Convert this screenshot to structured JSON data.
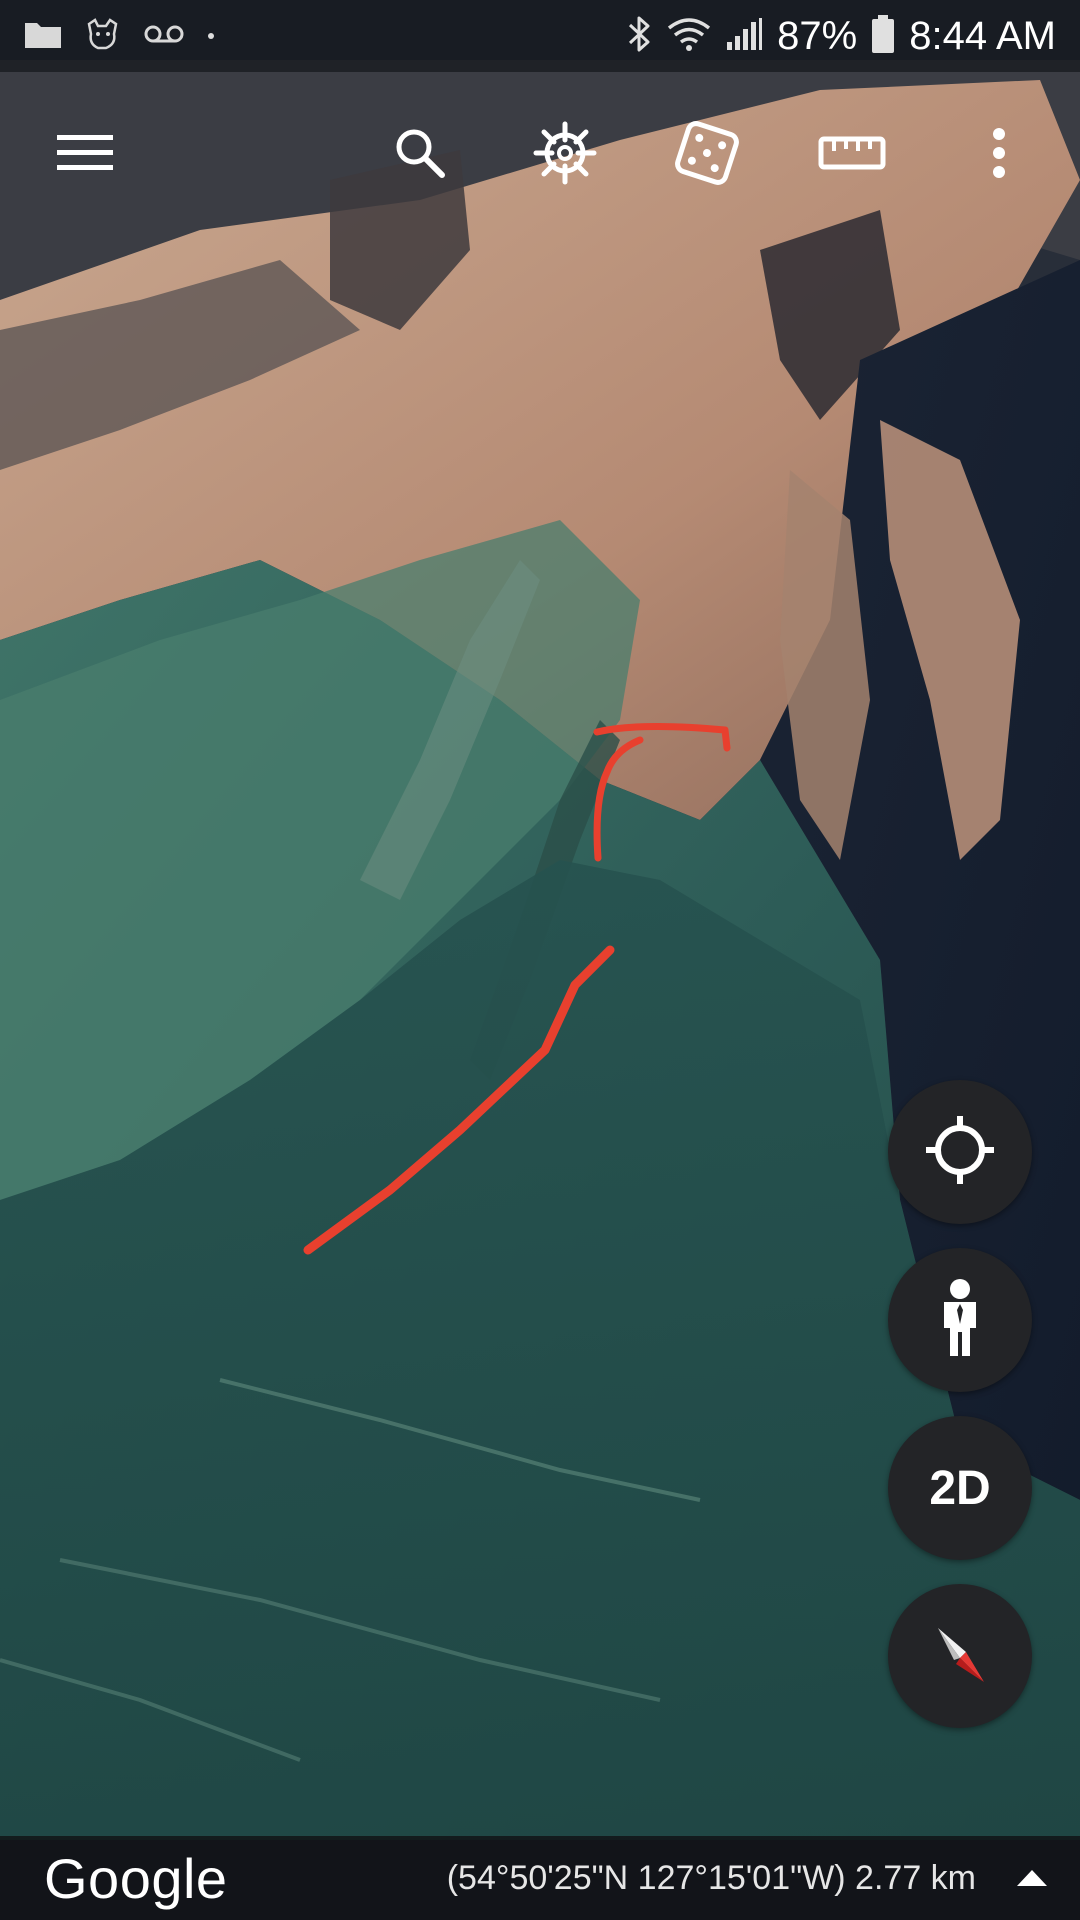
{
  "status_bar": {
    "battery_percent": "87%",
    "time": "8:44 AM",
    "left_icons": [
      "folder-icon",
      "cat-icon",
      "voicemail-icon",
      "dot-icon"
    ],
    "right_icons": [
      "bluetooth-icon",
      "wifi-icon",
      "signal-icon",
      "battery-icon"
    ]
  },
  "toolbar": {
    "icons": [
      "menu-icon",
      "search-icon",
      "voyager-wheel-icon",
      "dice-icon",
      "ruler-icon",
      "more-vert-icon"
    ]
  },
  "map_controls": {
    "view_mode_label": "2D",
    "icons": [
      "my-location-icon",
      "street-view-person-icon",
      "compass-icon"
    ]
  },
  "bottom_bar": {
    "logo_text": "Google",
    "coordinates": "(54°50'25\"N 127°15'01\"W) 2.77 km",
    "expand_icon": "caret-up-icon"
  },
  "colors": {
    "route_annotation": "#e8402e",
    "fab_background": "#232427",
    "compass_red": "#e53935"
  }
}
